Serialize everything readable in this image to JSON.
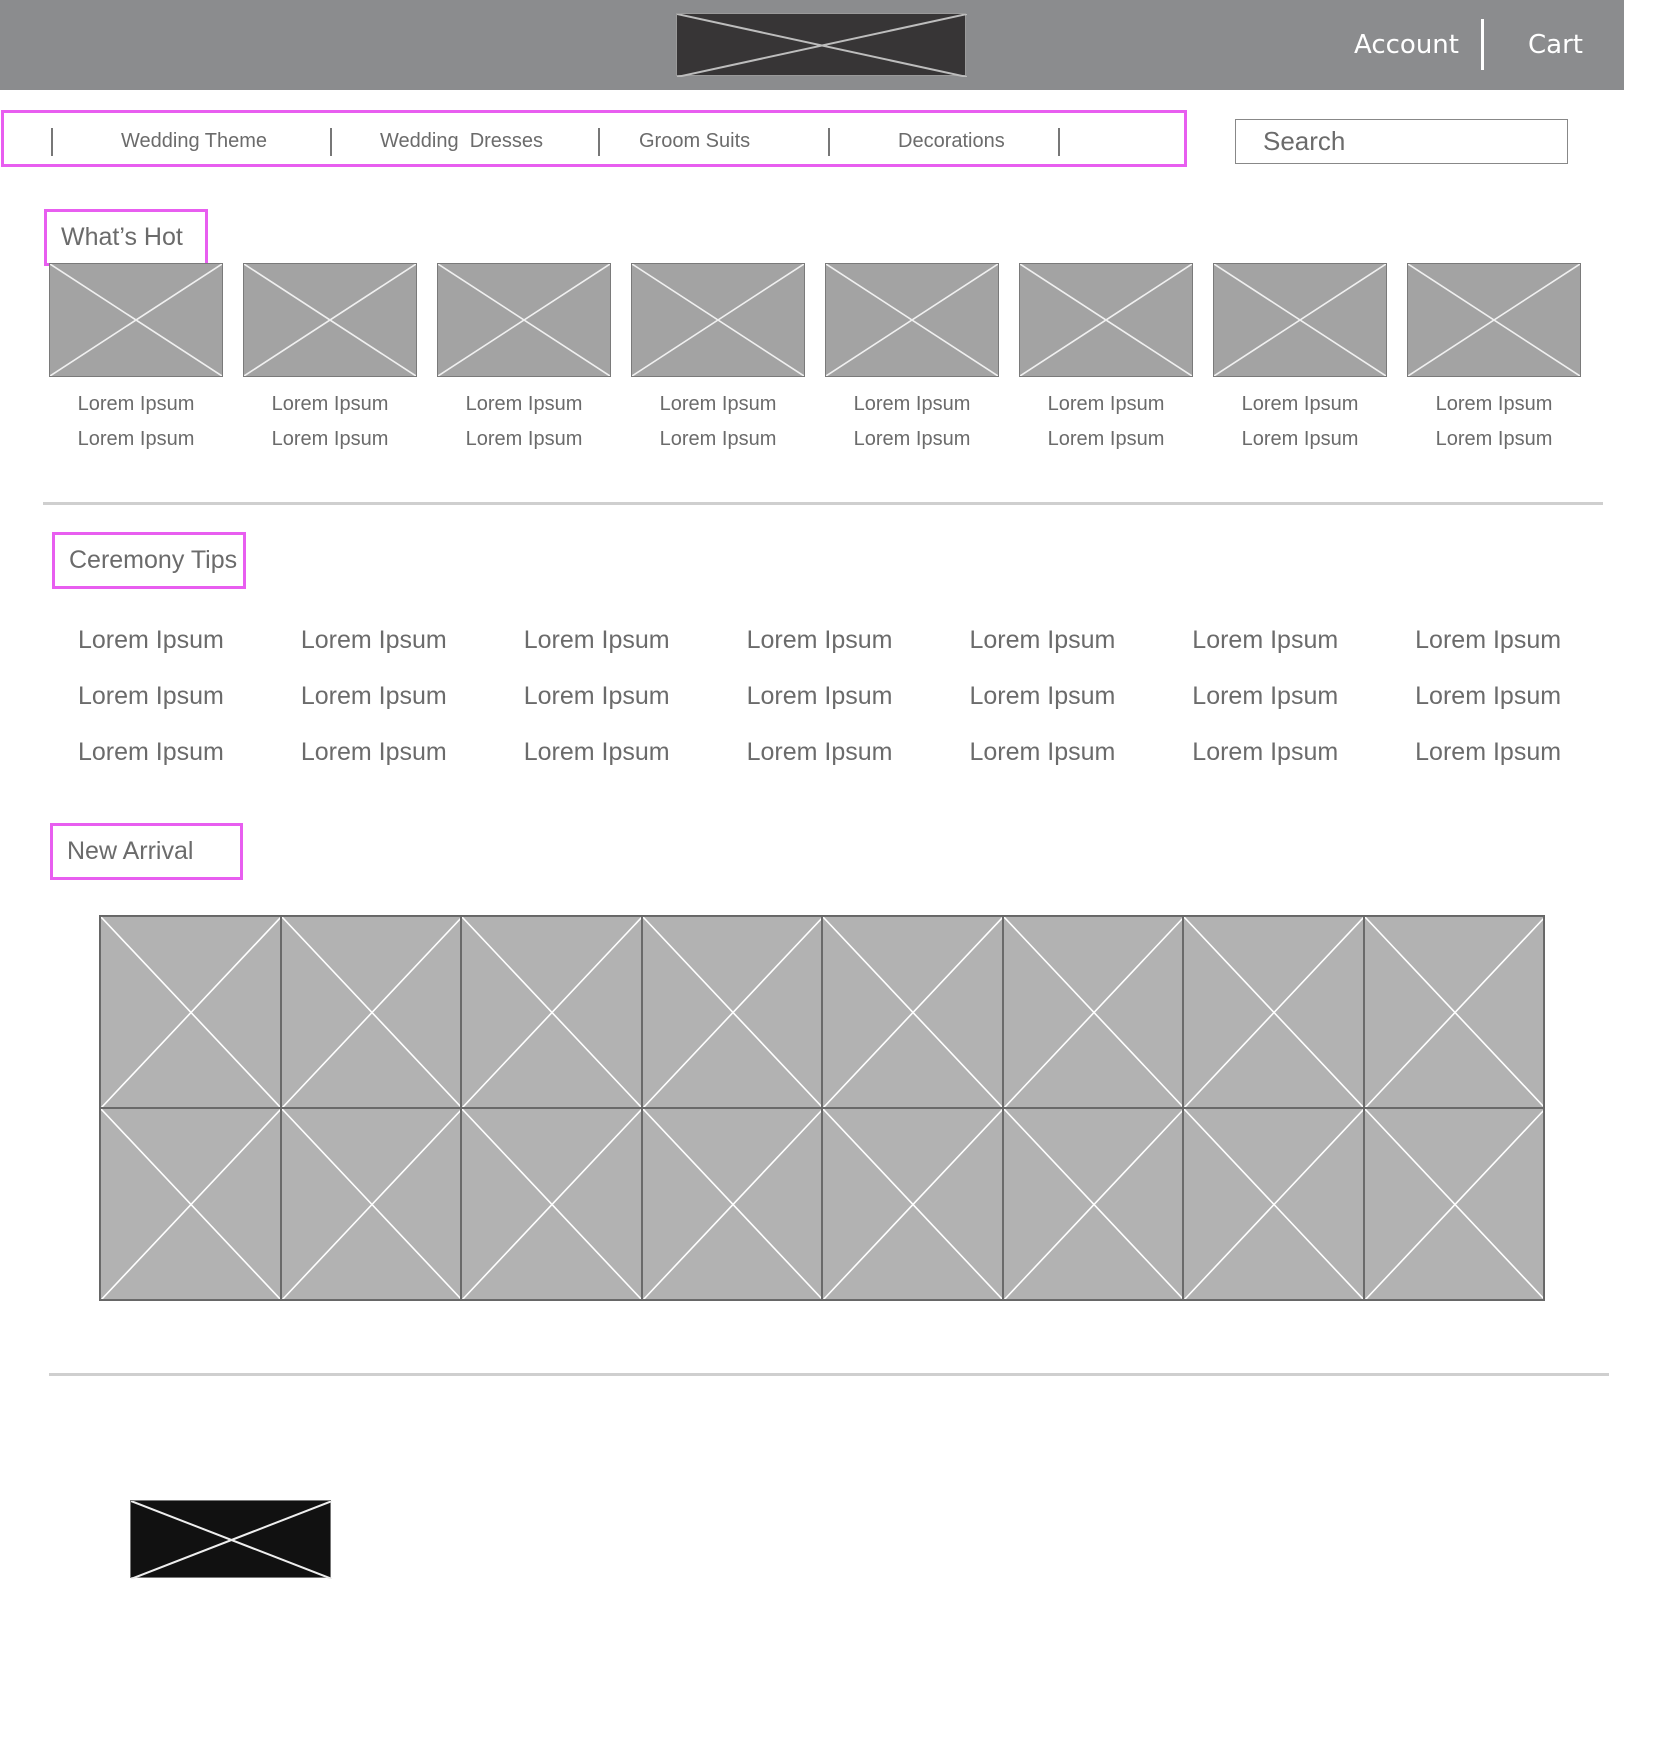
{
  "header": {
    "logo_icon": "image-placeholder-icon",
    "account_label": "Account",
    "cart_label": "Cart"
  },
  "nav": {
    "items": [
      {
        "label": "Wedding Theme"
      },
      {
        "label": "Wedding  Dresses"
      },
      {
        "label": "Groom Suits"
      },
      {
        "label": "Decorations"
      }
    ]
  },
  "search": {
    "placeholder": "Search",
    "value": ""
  },
  "whats_hot": {
    "title": "What’s Hot",
    "items": [
      {
        "line1": "Lorem Ipsum",
        "line2": "Lorem Ipsum"
      },
      {
        "line1": "Lorem Ipsum",
        "line2": "Lorem Ipsum"
      },
      {
        "line1": "Lorem Ipsum",
        "line2": "Lorem Ipsum"
      },
      {
        "line1": "Lorem Ipsum",
        "line2": "Lorem Ipsum"
      },
      {
        "line1": "Lorem Ipsum",
        "line2": "Lorem Ipsum"
      },
      {
        "line1": "Lorem Ipsum",
        "line2": "Lorem Ipsum"
      },
      {
        "line1": "Lorem Ipsum",
        "line2": "Lorem Ipsum"
      },
      {
        "line1": "Lorem Ipsum",
        "line2": "Lorem Ipsum"
      }
    ]
  },
  "ceremony_tips": {
    "title": "Ceremony Tips",
    "rows": [
      [
        "Lorem Ipsum",
        "Lorem Ipsum",
        "Lorem Ipsum",
        "Lorem Ipsum",
        "Lorem Ipsum",
        "Lorem Ipsum",
        "Lorem Ipsum"
      ],
      [
        "Lorem Ipsum",
        "Lorem Ipsum",
        "Lorem Ipsum",
        "Lorem Ipsum",
        "Lorem Ipsum",
        "Lorem Ipsum",
        "Lorem Ipsum"
      ],
      [
        "Lorem Ipsum",
        "Lorem Ipsum",
        "Lorem Ipsum",
        "Lorem Ipsum",
        "Lorem Ipsum",
        "Lorem Ipsum",
        "Lorem Ipsum"
      ]
    ]
  },
  "new_arrival": {
    "title": "New Arrival",
    "columns": 8,
    "rows": 2
  },
  "footer": {
    "logo_icon": "image-placeholder-icon"
  },
  "colors": {
    "header_bg": "#8b8c8e",
    "highlight_border": "#e85ef0",
    "placeholder_gray": "#a3a3a3",
    "text_gray": "#6b6b6b"
  }
}
